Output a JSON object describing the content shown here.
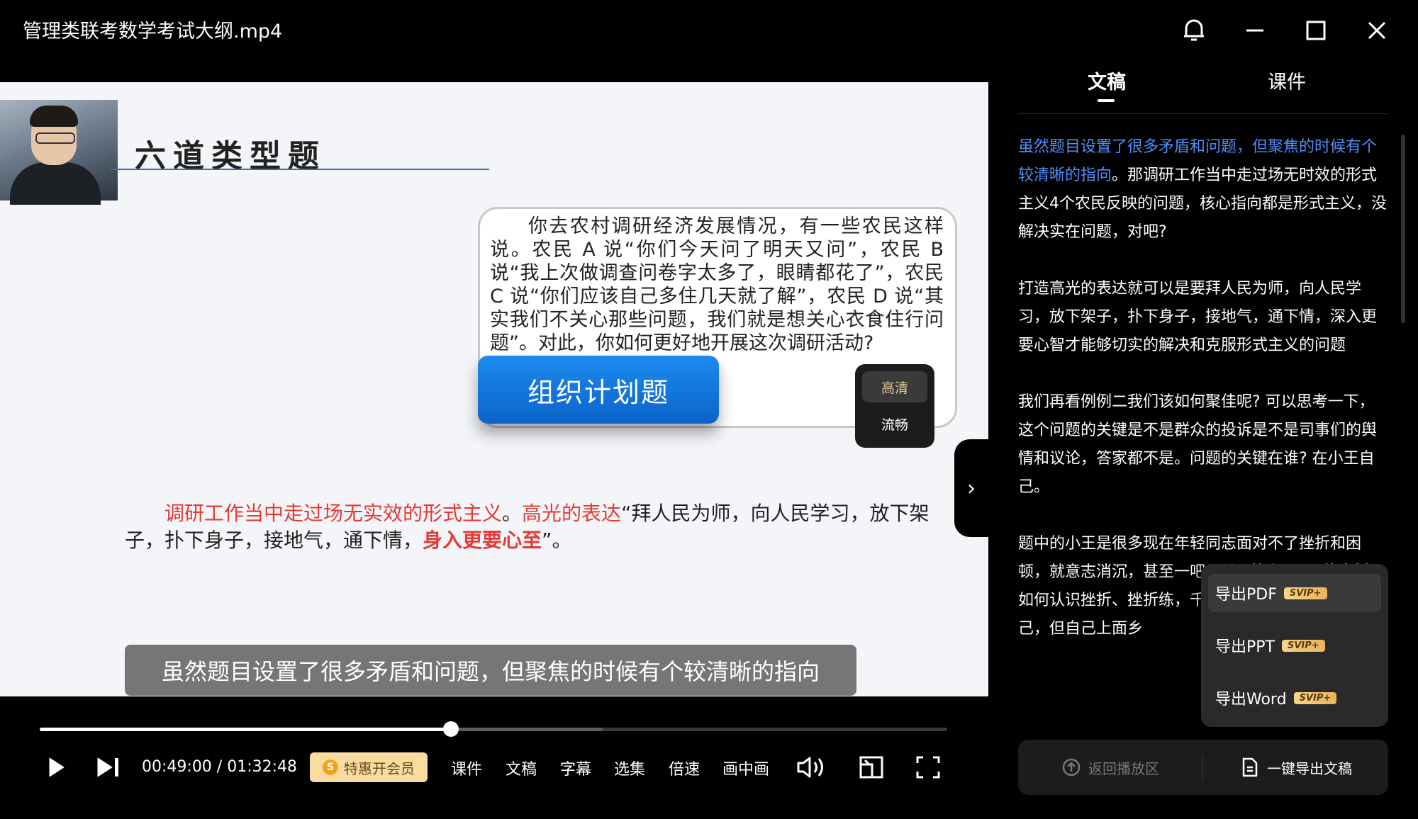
{
  "window": {
    "title": "管理类联考数学考试大纲.mp4"
  },
  "slide": {
    "heading": "六道类型题",
    "scenario_text": "你去农村调研经济发展情况，有一些农民这样说。农民 A 说“你们今天问了明天又问”，农民 B 说“我上次做调查问卷字太多了，眼睛都花了”，农民 C 说“你们应该自己多住几天就了解”，农民 D 说“其实我们不关心那些问题，我们就是想关心衣食住行问题”。对此，你如何更好地开展这次调研活动?",
    "badge": "组织计划题",
    "explanation": {
      "red1": "调研工作当中走过场无实效的形式主义",
      "sep1": "。",
      "red2": "高光的表达",
      "normal1": "“拜人民为师，向人民学习，放下架子，扑下身子，接地气，通下情，",
      "bold_red": "身入更要心至",
      "normal2": "”。"
    }
  },
  "quality_menu": {
    "selected": "高清",
    "other": "流畅"
  },
  "subtitle": "虽然题目设置了很多矛盾和问题，但聚焦的时候有个较清晰的指向",
  "player": {
    "progress": 0.453,
    "buffered": 0.62,
    "current_time": "00:49:00",
    "separator": " / ",
    "total_time": "01:32:48",
    "vip_label": "特惠开会员",
    "vip_coin": "S",
    "controls": [
      "课件",
      "文稿",
      "字幕",
      "选集",
      "倍速",
      "画中画"
    ]
  },
  "panel": {
    "tabs": [
      "文稿",
      "课件"
    ],
    "active_tab": "文稿",
    "transcript": {
      "p1_highlight": "虽然题目设置了很多矛盾和问题，但聚焦的时候有个较清晰的指向",
      "p1_rest": "。那调研工作当中走过场无时效的形式主义4个农民反映的问题，核心指向都是形式主义，没解决实在问题，对吧?",
      "p2": "打造高光的表达就可以是要拜人民为师，向人民学习，放下架子，扑下身子，接地气，通下情，深入更要心智才能够切实的解决和克服形式主义的问题",
      "p3": "我们再看例例二我们该如何聚佳呢? 可以思考一下，这个问题的关键是不是群众的投诉是不是司事们的舆情和议论，答家都不是。问题的关键在谁? 在小王自己。",
      "p4": "题中的小王是很多现在年轻同志面对不了挫折和困顿，就意志消沉，甚至一吧? 所以整个focus的点折，如何认识挫折、挫折练，千磨万击还坚韧，任有自己，但自己上面乡"
    },
    "export_menu": [
      {
        "label": "导出PDF",
        "badge": "SVIP+"
      },
      {
        "label": "导出PPT",
        "badge": "SVIP+"
      },
      {
        "label": "导出Word",
        "badge": "SVIP+"
      }
    ],
    "bottom": {
      "return_label": "返回播放区",
      "export_label": "一键导出文稿"
    }
  },
  "colors": {
    "highlight": "#4f8ef7",
    "accent_red": "#e53935",
    "badge_blue": "#1c8bf0",
    "vip_gold": "#f9dca0"
  }
}
